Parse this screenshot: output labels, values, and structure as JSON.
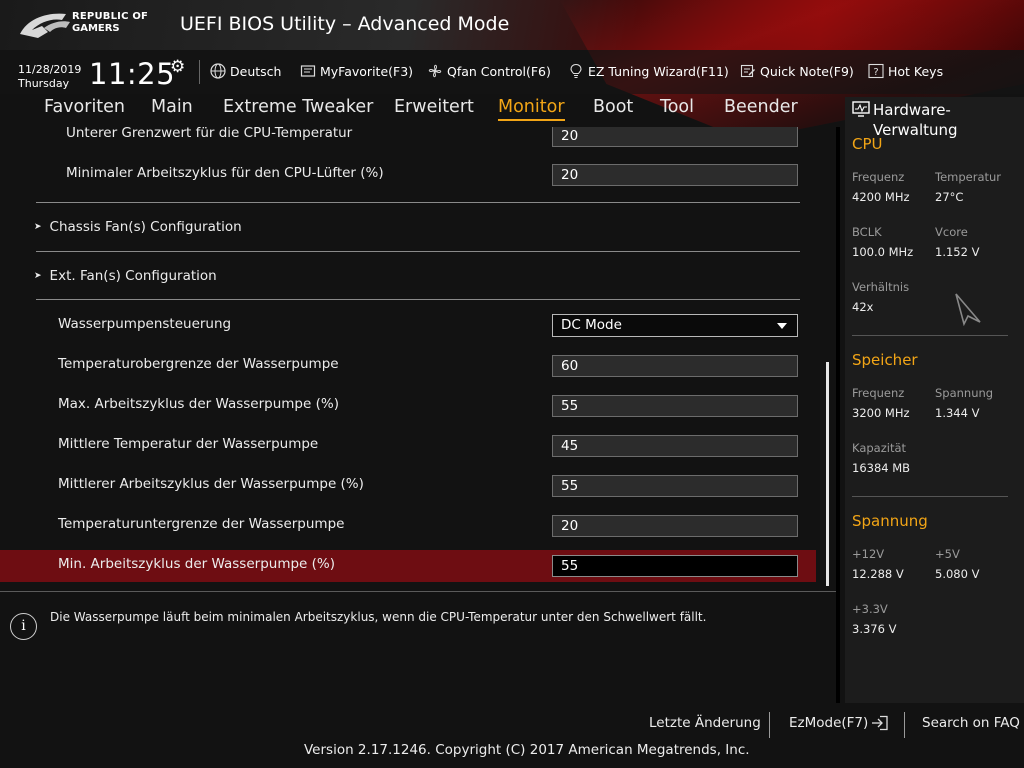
{
  "header": {
    "logo_line1": "REPUBLIC OF",
    "logo_line2": "GAMERS",
    "title": "UEFI BIOS Utility – Advanced Mode"
  },
  "infobar": {
    "date": "11/28/2019",
    "day": "Thursday",
    "time": "11:25",
    "language": "Deutsch",
    "myfavorite": "MyFavorite(F3)",
    "qfan": "Qfan Control(F6)",
    "ez_tuning": "EZ Tuning Wizard(F11)",
    "quick_note": "Quick Note(F9)",
    "hot_keys": "Hot Keys"
  },
  "tabs": [
    {
      "label": "Favoriten"
    },
    {
      "label": "Main"
    },
    {
      "label": "Extreme Tweaker"
    },
    {
      "label": "Erweitert"
    },
    {
      "label": "Monitor"
    },
    {
      "label": "Boot"
    },
    {
      "label": "Tool"
    },
    {
      "label": "Beender"
    }
  ],
  "active_tab": "Monitor",
  "main": {
    "rows_top": [
      {
        "label": "Unterer Grenzwert für die CPU-Temperatur",
        "value": "20"
      },
      {
        "label": "Minimaler Arbeitszyklus für den CPU-Lüfter (%)",
        "value": "20"
      }
    ],
    "sections": [
      {
        "label": "Chassis Fan(s) Configuration"
      },
      {
        "label": "Ext. Fan(s) Configuration"
      }
    ],
    "pump_control": {
      "label": "Wasserpumpensteuerung",
      "value": "DC Mode"
    },
    "rows_pump": [
      {
        "label": "Temperaturobergrenze der Wasserpumpe",
        "value": "60"
      },
      {
        "label": "Max. Arbeitszyklus der Wasserpumpe (%)",
        "value": "55"
      },
      {
        "label": "Mittlere Temperatur der Wasserpumpe",
        "value": "45"
      },
      {
        "label": "Mittlerer Arbeitszyklus der Wasserpumpe (%)",
        "value": "55"
      },
      {
        "label": "Temperaturuntergrenze der Wasserpumpe",
        "value": "20"
      }
    ],
    "selected_row": {
      "label": "Min. Arbeitszyklus der Wasserpumpe (%)",
      "value": "55"
    }
  },
  "help": {
    "icon": "info-icon",
    "text": "Die Wasserpumpe läuft beim minimalen Arbeitszyklus, wenn die CPU-Temperatur unter den Schwellwert fällt."
  },
  "hardware": {
    "title": "Hardware-Verwaltung",
    "cpu": {
      "heading": "CPU",
      "freq_label": "Frequenz",
      "freq": "4200 MHz",
      "temp_label": "Temperatur",
      "temp": "27°C",
      "bclk_label": "BCLK",
      "bclk": "100.0 MHz",
      "vcore_label": "Vcore",
      "vcore": "1.152 V",
      "ratio_label": "Verhältnis",
      "ratio": "42x"
    },
    "memory": {
      "heading": "Speicher",
      "freq_label": "Frequenz",
      "freq": "3200 MHz",
      "volt_label": "Spannung",
      "volt": "1.344 V",
      "cap_label": "Kapazität",
      "cap": "16384 MB"
    },
    "voltage": {
      "heading": "Spannung",
      "v12_label": "+12V",
      "v12": "12.288 V",
      "v5_label": "+5V",
      "v5": "5.080 V",
      "v33_label": "+3.3V",
      "v33": "3.376 V"
    }
  },
  "footer": {
    "last_change": "Letzte Änderung",
    "ezmode": "EzMode(F7)",
    "faq": "Search on FAQ",
    "version": "Version 2.17.1246. Copyright (C) 2017 American Megatrends, Inc."
  },
  "colors": {
    "accent": "#f2a516",
    "selected_row": "#6e0d12",
    "brand_red": "#b40a0a"
  }
}
